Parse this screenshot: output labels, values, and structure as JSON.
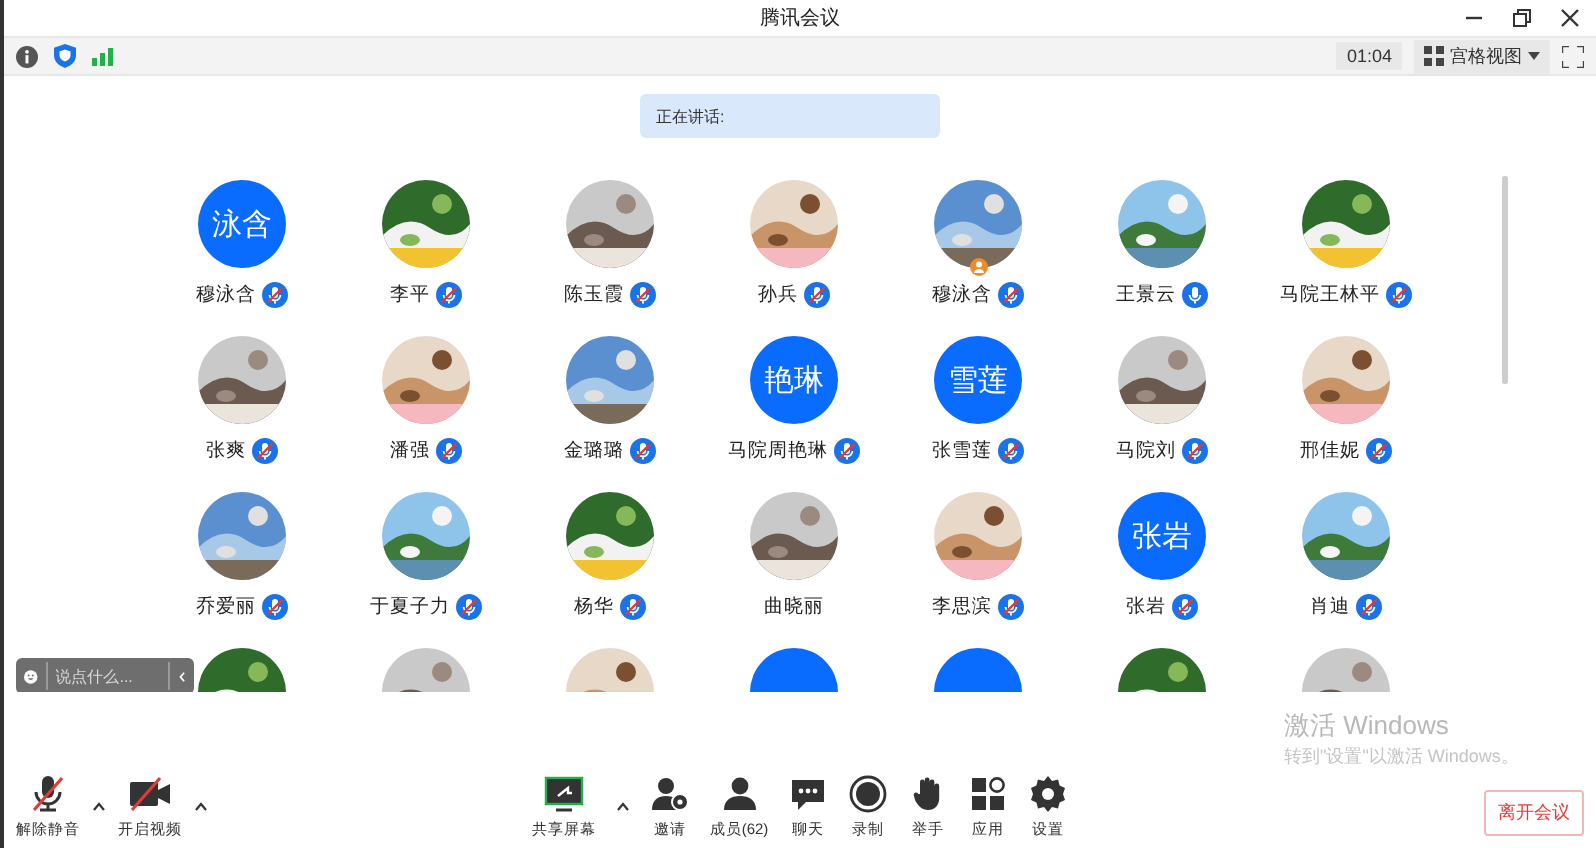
{
  "window": {
    "title": "腾讯会议"
  },
  "toolbar": {
    "timer": "01:04",
    "view_label": "宫格视图"
  },
  "speaking_banner": "正在讲话:",
  "participants": [
    {
      "name": "穆泳含",
      "kind": "initials",
      "initials": "泳含",
      "muted": true,
      "host": false
    },
    {
      "name": "李平",
      "kind": "picture",
      "muted": true,
      "host": false
    },
    {
      "name": "陈玉霞",
      "kind": "picture",
      "muted": true,
      "host": false
    },
    {
      "name": "孙兵",
      "kind": "picture",
      "muted": true,
      "host": false
    },
    {
      "name": "穆泳含",
      "kind": "picture",
      "muted": true,
      "host": true
    },
    {
      "name": "王景云",
      "kind": "picture",
      "muted": false,
      "host": false
    },
    {
      "name": "马院王林平",
      "kind": "picture",
      "muted": true,
      "host": false
    },
    {
      "name": "张爽",
      "kind": "picture",
      "muted": true,
      "host": false
    },
    {
      "name": "潘强",
      "kind": "picture",
      "muted": true,
      "host": false
    },
    {
      "name": "金璐璐",
      "kind": "picture",
      "muted": true,
      "host": false
    },
    {
      "name": "马院周艳琳",
      "kind": "initials",
      "initials": "艳琳",
      "muted": true,
      "host": false
    },
    {
      "name": "张雪莲",
      "kind": "initials",
      "initials": "雪莲",
      "muted": true,
      "host": false
    },
    {
      "name": "马院刘",
      "kind": "picture",
      "muted": true,
      "host": false
    },
    {
      "name": "邢佳妮",
      "kind": "picture",
      "muted": true,
      "host": false
    },
    {
      "name": "乔爱丽",
      "kind": "picture",
      "muted": true,
      "host": false
    },
    {
      "name": "于夏子力",
      "kind": "picture",
      "muted": true,
      "host": false
    },
    {
      "name": "杨华",
      "kind": "picture",
      "muted": true,
      "host": false
    },
    {
      "name": "曲晓丽",
      "kind": "picture",
      "host": false
    },
    {
      "name": "李思滨",
      "kind": "picture",
      "muted": true,
      "host": false
    },
    {
      "name": "张岩",
      "kind": "initials",
      "initials": "张岩",
      "muted": true,
      "host": false
    },
    {
      "name": "肖迪",
      "kind": "picture",
      "muted": true,
      "host": false
    },
    {
      "kind": "picture"
    },
    {
      "kind": "picture"
    },
    {
      "kind": "picture"
    },
    {
      "kind": "initials"
    },
    {
      "kind": "initials"
    },
    {
      "kind": "picture"
    },
    {
      "kind": "picture"
    }
  ],
  "chat_input": {
    "placeholder": "说点什么..."
  },
  "left_controls": [
    {
      "kind": "mic-off",
      "label": "解除静音",
      "caret": true
    },
    {
      "kind": "video-off",
      "label": "开启视频",
      "caret": true
    }
  ],
  "center_controls": [
    {
      "kind": "share",
      "label": "共享屏幕",
      "caret": true
    },
    {
      "kind": "invite",
      "label": "邀请",
      "caret": false
    },
    {
      "kind": "members",
      "label": "成员(62)",
      "caret": false
    },
    {
      "kind": "chat",
      "label": "聊天",
      "caret": false
    },
    {
      "kind": "record",
      "label": "录制",
      "caret": false
    },
    {
      "kind": "hand",
      "label": "举手",
      "caret": false
    },
    {
      "kind": "apps",
      "label": "应用",
      "caret": false
    },
    {
      "kind": "settings",
      "label": "设置",
      "caret": false
    }
  ],
  "leave_button": "离开会议",
  "os_notice": {
    "title": "激活 Windows",
    "text": "转到\"设置\"以激活 Windows。"
  }
}
